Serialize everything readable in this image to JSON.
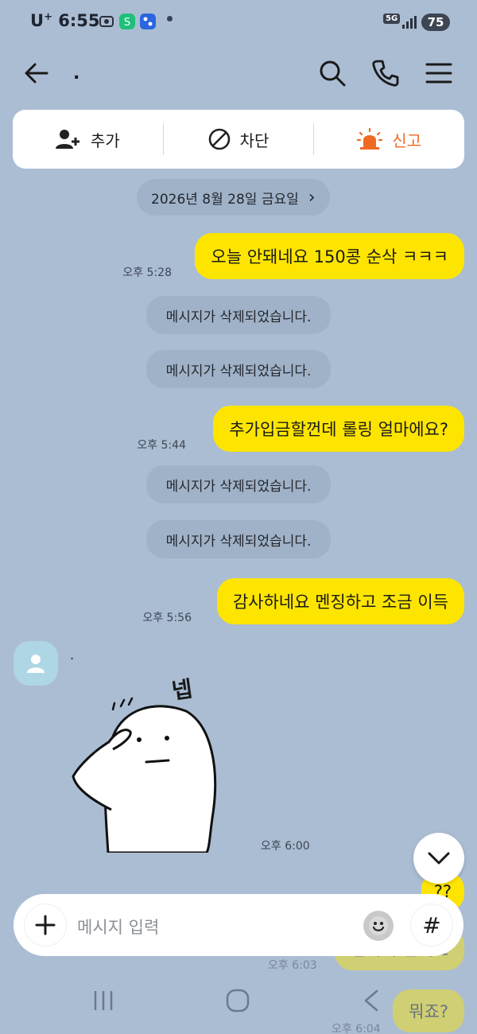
{
  "status_bar": {
    "carrier": "U",
    "carrier_sup": "+",
    "time": "6:55",
    "network": "5G",
    "battery": "75"
  },
  "header": {
    "title": "."
  },
  "action_bar": {
    "add_label": "추가",
    "block_label": "차단",
    "report_label": "신고"
  },
  "date_divider": {
    "label": "2026년 8월 28일 금요일",
    "arrow": "›"
  },
  "messages": [
    {
      "text": "오늘 안돼네요 150콩 순삭 ㅋㅋㅋ",
      "time": "오후 5:28"
    },
    {
      "text": "메시지가 삭제되었습니다."
    },
    {
      "text": "메시지가 삭제되었습니다."
    },
    {
      "text": "추가입금할껀데 롤링 얼마에요?",
      "time": "오후 5:44"
    },
    {
      "text": "메시지가 삭제되었습니다."
    },
    {
      "text": "메시지가 삭제되었습니다."
    },
    {
      "text": "감사하네요 멘징하고 조금 이득",
      "time": "오후 5:56"
    },
    {
      "sender": ".",
      "sticker_text": "넵",
      "time": "오후 6:00"
    },
    {
      "text": "??"
    },
    {
      "text": "접속이 안돼요",
      "time": "오후 6:03"
    },
    {
      "text": "뭐죠?",
      "time": "오후 6:04"
    }
  ],
  "input": {
    "placeholder": "메시지 입력",
    "hash": "#"
  },
  "colors": {
    "background": "#abbdd3",
    "my_bubble": "#fee500",
    "report_accent": "#ef6a23",
    "avatar": "#aed6e4"
  },
  "icons": {
    "back": "arrow-left",
    "search": "magnifier",
    "call": "phone",
    "menu": "hamburger",
    "add_friend": "person-plus",
    "block": "circle-slash",
    "report": "siren",
    "scroll_down": "chevron-down",
    "attach": "plus",
    "emoji": "smiley",
    "nav_recent": "three-bars",
    "nav_home": "rounded-square",
    "nav_back": "chevron-left"
  }
}
